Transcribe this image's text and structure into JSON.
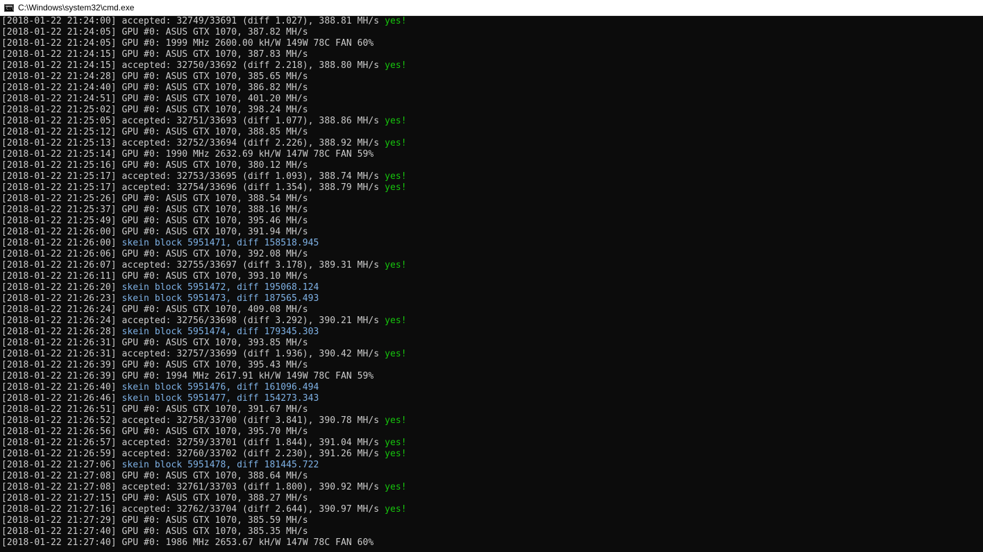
{
  "window": {
    "title": "C:\\Windows\\system32\\cmd.exe",
    "icon_text": "C:\\"
  },
  "colors": {
    "background": "#0c0c0c",
    "text": "#cccccc",
    "accepted_ok": "#16c60c",
    "block": "#7fb2e6"
  },
  "lines": [
    {
      "ts": "[2018-01-22 21:24:00]",
      "msg": " accepted: 32749/33691 (diff 1.027), 388.81 MH/s ",
      "ok": "yes!"
    },
    {
      "ts": "[2018-01-22 21:24:05]",
      "msg": " GPU #0: ASUS GTX 1070, 387.82 MH/s"
    },
    {
      "ts": "[2018-01-22 21:24:05]",
      "msg": " GPU #0: 1999 MHz 2600.00 kH/W 149W 78C FAN 60%"
    },
    {
      "ts": "[2018-01-22 21:24:15]",
      "msg": " GPU #0: ASUS GTX 1070, 387.83 MH/s"
    },
    {
      "ts": "[2018-01-22 21:24:15]",
      "msg": " accepted: 32750/33692 (diff 2.218), 388.80 MH/s ",
      "ok": "yes!"
    },
    {
      "ts": "[2018-01-22 21:24:28]",
      "msg": " GPU #0: ASUS GTX 1070, 385.65 MH/s"
    },
    {
      "ts": "[2018-01-22 21:24:40]",
      "msg": " GPU #0: ASUS GTX 1070, 386.82 MH/s"
    },
    {
      "ts": "[2018-01-22 21:24:51]",
      "msg": " GPU #0: ASUS GTX 1070, 401.20 MH/s"
    },
    {
      "ts": "[2018-01-22 21:25:02]",
      "msg": " GPU #0: ASUS GTX 1070, 398.24 MH/s"
    },
    {
      "ts": "[2018-01-22 21:25:05]",
      "msg": " accepted: 32751/33693 (diff 1.077), 388.86 MH/s ",
      "ok": "yes!"
    },
    {
      "ts": "[2018-01-22 21:25:12]",
      "msg": " GPU #0: ASUS GTX 1070, 388.85 MH/s"
    },
    {
      "ts": "[2018-01-22 21:25:13]",
      "msg": " accepted: 32752/33694 (diff 2.226), 388.92 MH/s ",
      "ok": "yes!"
    },
    {
      "ts": "[2018-01-22 21:25:14]",
      "msg": " GPU #0: 1990 MHz 2632.69 kH/W 147W 78C FAN 59%"
    },
    {
      "ts": "[2018-01-22 21:25:16]",
      "msg": " GPU #0: ASUS GTX 1070, 380.12 MH/s"
    },
    {
      "ts": "[2018-01-22 21:25:17]",
      "msg": " accepted: 32753/33695 (diff 1.093), 388.74 MH/s ",
      "ok": "yes!"
    },
    {
      "ts": "[2018-01-22 21:25:17]",
      "msg": " accepted: 32754/33696 (diff 1.354), 388.79 MH/s ",
      "ok": "yes!"
    },
    {
      "ts": "[2018-01-22 21:25:26]",
      "msg": " GPU #0: ASUS GTX 1070, 388.54 MH/s"
    },
    {
      "ts": "[2018-01-22 21:25:37]",
      "msg": " GPU #0: ASUS GTX 1070, 388.16 MH/s"
    },
    {
      "ts": "[2018-01-22 21:25:49]",
      "msg": " GPU #0: ASUS GTX 1070, 395.46 MH/s"
    },
    {
      "ts": "[2018-01-22 21:26:00]",
      "msg": " GPU #0: ASUS GTX 1070, 391.94 MH/s"
    },
    {
      "ts": "[2018-01-22 21:26:00]",
      "msg": " skein block 5951471, diff 158518.945",
      "block": true
    },
    {
      "ts": "[2018-01-22 21:26:06]",
      "msg": " GPU #0: ASUS GTX 1070, 392.08 MH/s"
    },
    {
      "ts": "[2018-01-22 21:26:07]",
      "msg": " accepted: 32755/33697 (diff 3.178), 389.31 MH/s ",
      "ok": "yes!"
    },
    {
      "ts": "[2018-01-22 21:26:11]",
      "msg": " GPU #0: ASUS GTX 1070, 393.10 MH/s"
    },
    {
      "ts": "[2018-01-22 21:26:20]",
      "msg": " skein block 5951472, diff 195068.124",
      "block": true
    },
    {
      "ts": "[2018-01-22 21:26:23]",
      "msg": " skein block 5951473, diff 187565.493",
      "block": true
    },
    {
      "ts": "[2018-01-22 21:26:24]",
      "msg": " GPU #0: ASUS GTX 1070, 409.08 MH/s"
    },
    {
      "ts": "[2018-01-22 21:26:24]",
      "msg": " accepted: 32756/33698 (diff 3.292), 390.21 MH/s ",
      "ok": "yes!"
    },
    {
      "ts": "[2018-01-22 21:26:28]",
      "msg": " skein block 5951474, diff 179345.303",
      "block": true
    },
    {
      "ts": "[2018-01-22 21:26:31]",
      "msg": " GPU #0: ASUS GTX 1070, 393.85 MH/s"
    },
    {
      "ts": "[2018-01-22 21:26:31]",
      "msg": " accepted: 32757/33699 (diff 1.936), 390.42 MH/s ",
      "ok": "yes!"
    },
    {
      "ts": "[2018-01-22 21:26:39]",
      "msg": " GPU #0: ASUS GTX 1070, 395.43 MH/s"
    },
    {
      "ts": "[2018-01-22 21:26:39]",
      "msg": " GPU #0: 1994 MHz 2617.91 kH/W 149W 78C FAN 59%"
    },
    {
      "ts": "[2018-01-22 21:26:40]",
      "msg": " skein block 5951476, diff 161096.494",
      "block": true
    },
    {
      "ts": "[2018-01-22 21:26:46]",
      "msg": " skein block 5951477, diff 154273.343",
      "block": true
    },
    {
      "ts": "[2018-01-22 21:26:51]",
      "msg": " GPU #0: ASUS GTX 1070, 391.67 MH/s"
    },
    {
      "ts": "[2018-01-22 21:26:52]",
      "msg": " accepted: 32758/33700 (diff 3.841), 390.78 MH/s ",
      "ok": "yes!"
    },
    {
      "ts": "[2018-01-22 21:26:56]",
      "msg": " GPU #0: ASUS GTX 1070, 395.70 MH/s"
    },
    {
      "ts": "[2018-01-22 21:26:57]",
      "msg": " accepted: 32759/33701 (diff 1.844), 391.04 MH/s ",
      "ok": "yes!"
    },
    {
      "ts": "[2018-01-22 21:26:59]",
      "msg": " accepted: 32760/33702 (diff 2.230), 391.26 MH/s ",
      "ok": "yes!"
    },
    {
      "ts": "[2018-01-22 21:27:06]",
      "msg": " skein block 5951478, diff 181445.722",
      "block": true
    },
    {
      "ts": "[2018-01-22 21:27:08]",
      "msg": " GPU #0: ASUS GTX 1070, 388.64 MH/s"
    },
    {
      "ts": "[2018-01-22 21:27:08]",
      "msg": " accepted: 32761/33703 (diff 1.800), 390.92 MH/s ",
      "ok": "yes!"
    },
    {
      "ts": "[2018-01-22 21:27:15]",
      "msg": " GPU #0: ASUS GTX 1070, 388.27 MH/s"
    },
    {
      "ts": "[2018-01-22 21:27:16]",
      "msg": " accepted: 32762/33704 (diff 2.644), 390.97 MH/s ",
      "ok": "yes!"
    },
    {
      "ts": "[2018-01-22 21:27:29]",
      "msg": " GPU #0: ASUS GTX 1070, 385.59 MH/s"
    },
    {
      "ts": "[2018-01-22 21:27:40]",
      "msg": " GPU #0: ASUS GTX 1070, 385.35 MH/s"
    },
    {
      "ts": "[2018-01-22 21:27:40]",
      "msg": " GPU #0: 1986 MHz 2653.67 kH/W 147W 78C FAN 60%"
    }
  ]
}
